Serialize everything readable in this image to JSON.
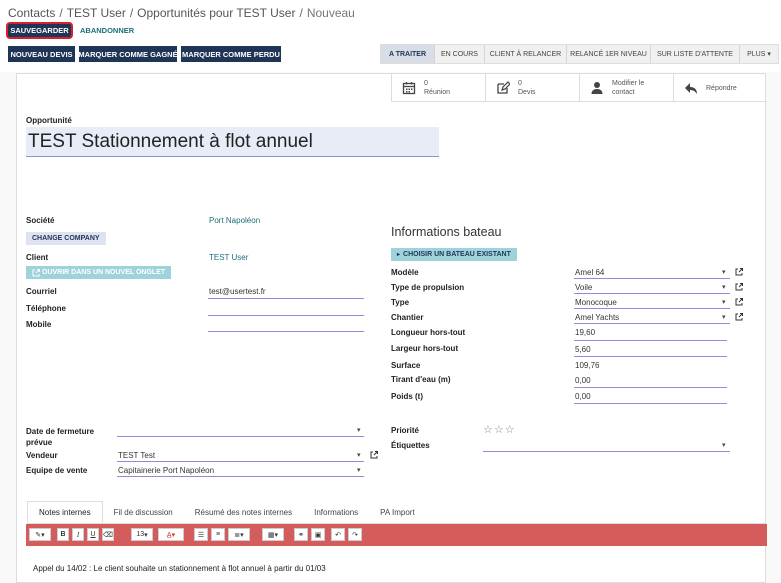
{
  "breadcrumb": [
    "Contacts",
    "TEST User",
    "Opportunités pour TEST User",
    "Nouveau"
  ],
  "buttons": {
    "save": "SAUVEGARDER",
    "discard": "ABANDONNER"
  },
  "actions": [
    "NOUVEAU DEVIS",
    "MARQUER COMME GAGNÉ",
    "MARQUER COMME PERDU"
  ],
  "stages": [
    "A TRAITER",
    "EN COURS",
    "CLIENT À RELANCER",
    "RELANCÉ 1ER NIVEAU",
    "SUR LISTE D'ATTENTE",
    "PLUS ▾"
  ],
  "smart_buttons": [
    {
      "line1": "0",
      "line2": "Réunion",
      "icon": "calendar-icon"
    },
    {
      "line1": "0",
      "line2": "Devis",
      "icon": "pencil-square-icon"
    },
    {
      "line1": "Modifier le",
      "line2": "contact",
      "icon": "user-icon"
    },
    {
      "line1": "Répondre",
      "line2": "",
      "icon": "reply-icon"
    }
  ],
  "opportunity": {
    "label": "Opportunité",
    "title": "TEST Stationnement à flot annuel"
  },
  "left": {
    "societe_label": "Société",
    "societe_value": "Port Napoléon",
    "change_company": "CHANGE COMPANY",
    "client_label": "Client",
    "client_value": "TEST User",
    "open_new_tab": "OUVRIR DANS UN NOUVEL ONGLET",
    "courriel_label": "Courriel",
    "courriel_value": "test@usertest.fr",
    "telephone_label": "Téléphone",
    "telephone_value": "",
    "mobile_label": "Mobile",
    "mobile_value": ""
  },
  "bateau": {
    "title": "Informations bateau",
    "choose": "CHOISIR UN BATEAU EXISTANT",
    "modele_label": "Modèle",
    "modele_value": "Amel 64",
    "propulsion_label": "Type de propulsion",
    "propulsion_value": "Voile",
    "type_label": "Type",
    "type_value": "Monocoque",
    "chantier_label": "Chantier",
    "chantier_value": "Amel Yachts",
    "longueur_label": "Longueur hors-tout",
    "longueur_value": "19,60",
    "largeur_label": "Largeur hors-tout",
    "largeur_value": "5,60",
    "surface_label": "Surface",
    "surface_value": "109,76",
    "tirant_label": "Tirant d'eau (m)",
    "tirant_value": "0,00",
    "poids_label": "Poids (t)",
    "poids_value": "0,00"
  },
  "bottom": {
    "date_label": "Date de fermeture",
    "date_label2": "prévue",
    "date_value": "",
    "vendeur_label": "Vendeur",
    "vendeur_value": "TEST Test",
    "equipe_label": "Equipe de vente",
    "equipe_value": "Capitainerie Port Napoléon",
    "priorite_label": "Priorité",
    "priority_stars": 0,
    "priority_max": 3,
    "etiquettes_label": "Étiquettes",
    "etiquettes_value": ""
  },
  "tabs": [
    "Notes internes",
    "Fil de discussion",
    "Résumé des notes internes",
    "Informations",
    "PA Import"
  ],
  "editor": {
    "font_size": "13",
    "content": "Appel du 14/02 : Le client souhaite un stationnement à flot annuel à partir du 01/03"
  },
  "colors": {
    "primary": "#1f3558",
    "accent": "#1d6f78",
    "toolbar": "#d45c5c",
    "save_border": "#d9202a"
  }
}
